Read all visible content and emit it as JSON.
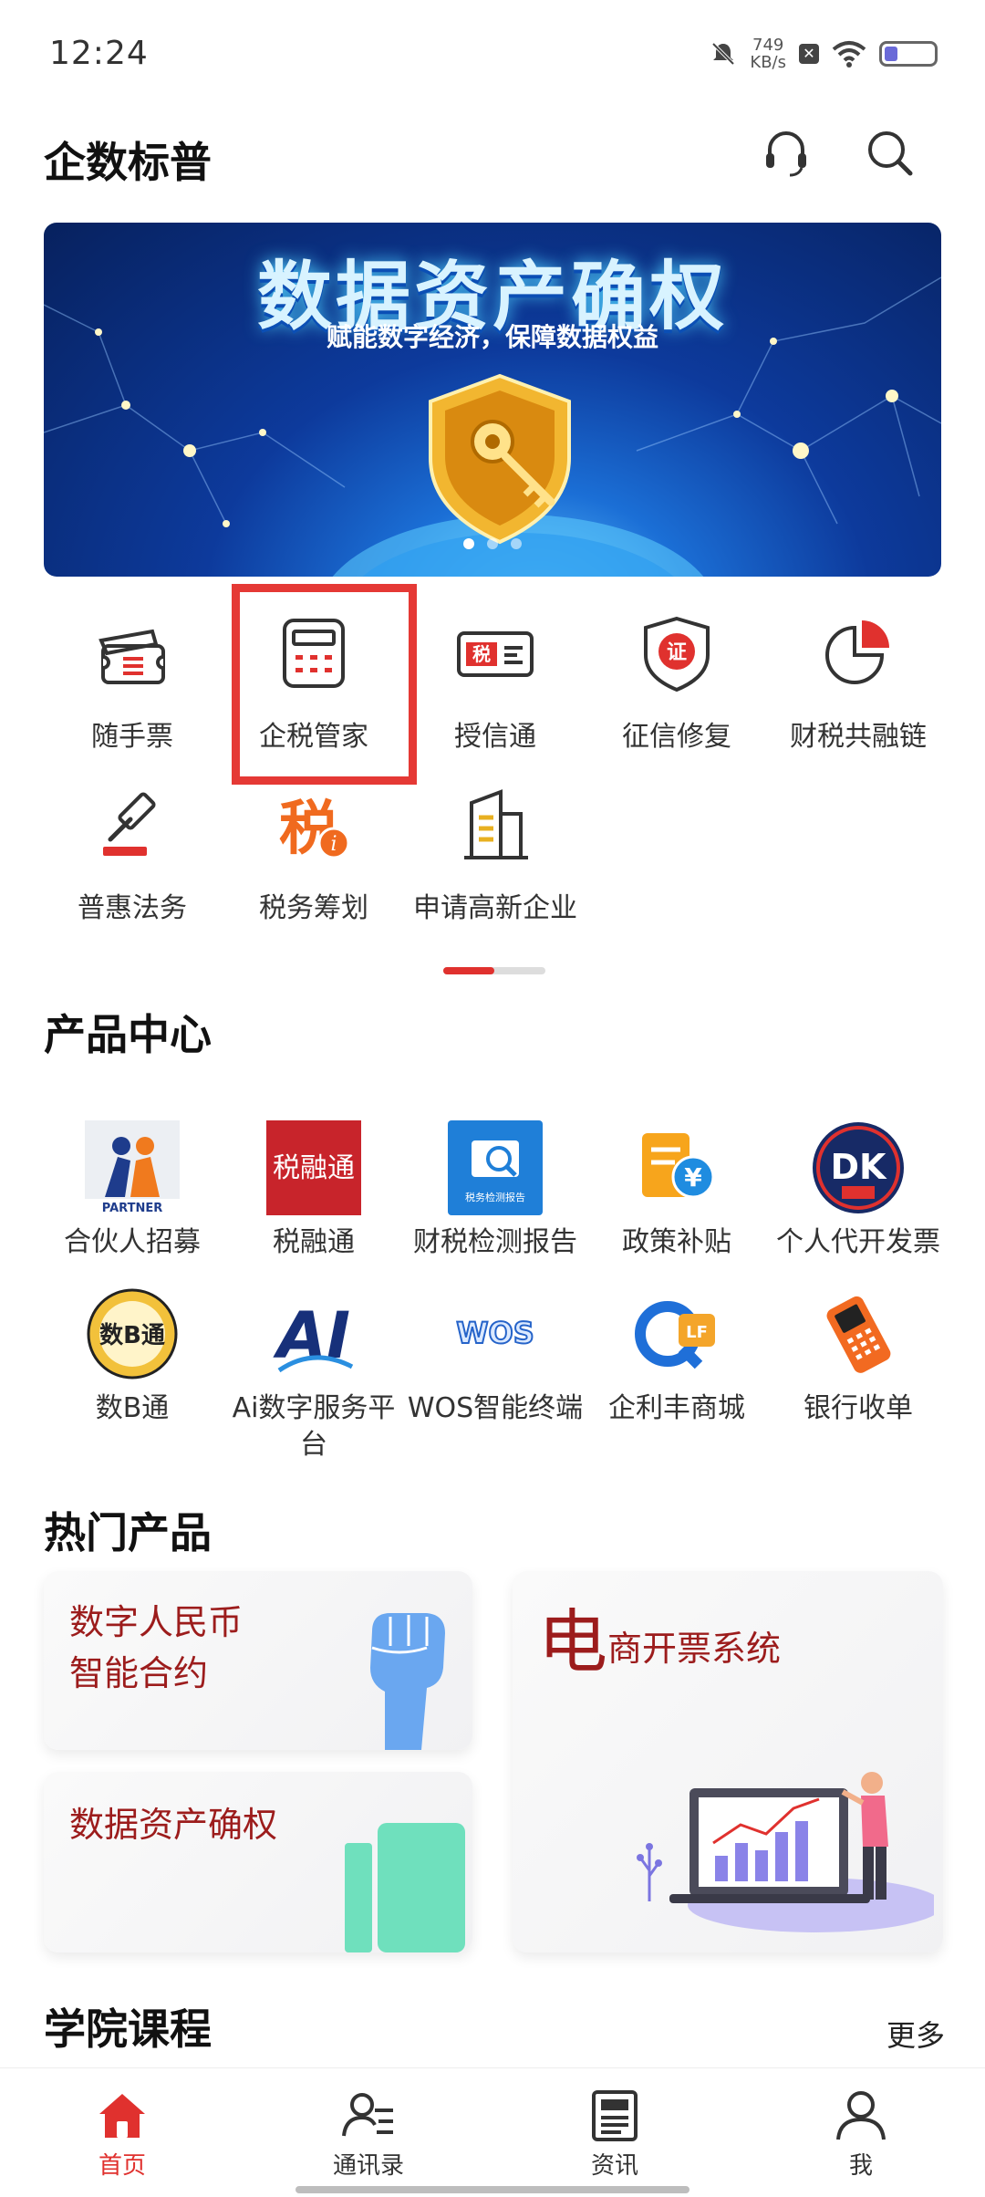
{
  "status_bar": {
    "time": "12:24",
    "net_speed_value": "749",
    "net_speed_unit": "KB/s"
  },
  "header": {
    "title": "企数标普",
    "icons": [
      "headset-icon",
      "search-icon"
    ]
  },
  "banner": {
    "title": "数据资产确权",
    "subtitle": "赋能数字经济，保障数据权益",
    "page_count": 3,
    "active_page": 1
  },
  "quick_grid": {
    "items": [
      {
        "label": "随手票",
        "icon": "ticket-icon"
      },
      {
        "label": "企税管家",
        "icon": "calculator-icon",
        "highlighted": true
      },
      {
        "label": "授信通",
        "icon": "tax-card-icon"
      },
      {
        "label": "征信修复",
        "icon": "shield-cert-icon"
      },
      {
        "label": "财税共融链",
        "icon": "pie-chart-icon"
      },
      {
        "label": "普惠法务",
        "icon": "gavel-icon"
      },
      {
        "label": "税务筹划",
        "icon": "tax-plan-icon"
      },
      {
        "label": "申请高新企业",
        "icon": "building-icon"
      }
    ],
    "pager_progress": 0.5
  },
  "products": {
    "title": "产品中心",
    "items": [
      {
        "label": "合伙人招募",
        "icon": "partner-logo-icon",
        "logo_text": "PARTNER"
      },
      {
        "label": "税融通",
        "icon": "shuirongtong-logo-icon",
        "logo_text": "税融通"
      },
      {
        "label": "财税检测报告",
        "icon": "report-search-icon",
        "logo_text": "税务检测报告"
      },
      {
        "label": "政策补贴",
        "icon": "subsidy-yen-icon"
      },
      {
        "label": "个人代开发票",
        "icon": "dk-invoice-logo-icon",
        "logo_text": "DK"
      },
      {
        "label": "数B通",
        "icon": "shubitong-logo-icon",
        "logo_text": "数B通"
      },
      {
        "label": "Ai数字服务平台",
        "icon": "ai-logo-icon",
        "logo_text": "AI"
      },
      {
        "label": "WOS智能终端",
        "icon": "wos-logo-icon",
        "logo_text": "WOS"
      },
      {
        "label": "企利丰商城",
        "icon": "qlf-logo-icon",
        "logo_text": "Q LF"
      },
      {
        "label": "银行收单",
        "icon": "pos-terminal-icon"
      }
    ]
  },
  "hot": {
    "title": "热门产品",
    "cards": [
      {
        "line1": "数字人民币",
        "line2": "智能合约"
      },
      {
        "line1": "数据资产确权"
      },
      {
        "first_char": "电",
        "rest": "商开票系统"
      }
    ]
  },
  "academy": {
    "title": "学院课程",
    "more": "更多"
  },
  "nav": {
    "items": [
      {
        "label": "首页",
        "icon": "home-icon",
        "active": true
      },
      {
        "label": "通讯录",
        "icon": "contacts-icon"
      },
      {
        "label": "资讯",
        "icon": "news-icon"
      },
      {
        "label": "我",
        "icon": "profile-icon"
      }
    ]
  },
  "colors": {
    "accent": "#e0312e",
    "highlight_border": "#e53935",
    "card_text": "#9c1c1c",
    "banner_title": "#d8f3ff"
  }
}
